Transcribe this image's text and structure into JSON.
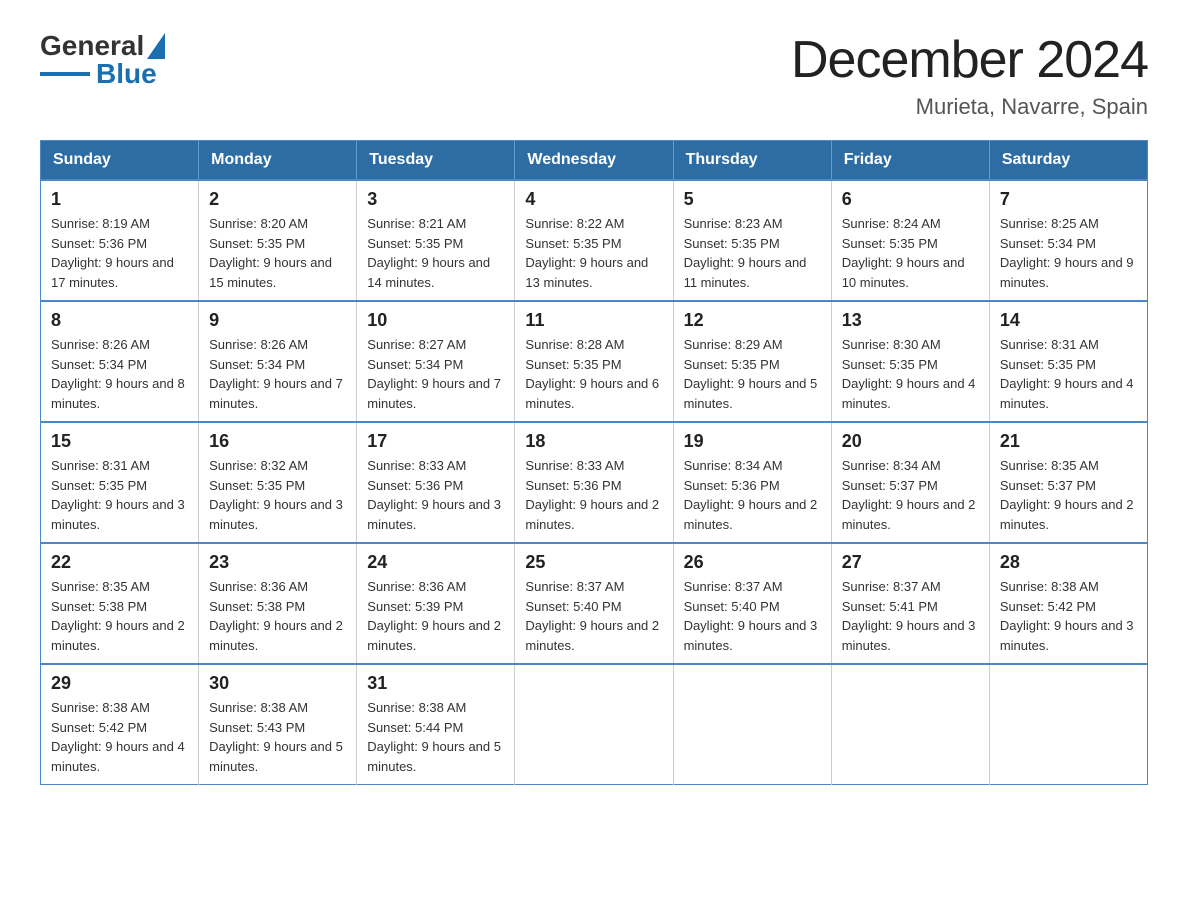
{
  "header": {
    "logo_general": "General",
    "logo_blue": "Blue",
    "month_year": "December 2024",
    "location": "Murieta, Navarre, Spain"
  },
  "days_of_week": [
    "Sunday",
    "Monday",
    "Tuesday",
    "Wednesday",
    "Thursday",
    "Friday",
    "Saturday"
  ],
  "weeks": [
    [
      {
        "day": "1",
        "sunrise": "8:19 AM",
        "sunset": "5:36 PM",
        "daylight": "9 hours and 17 minutes."
      },
      {
        "day": "2",
        "sunrise": "8:20 AM",
        "sunset": "5:35 PM",
        "daylight": "9 hours and 15 minutes."
      },
      {
        "day": "3",
        "sunrise": "8:21 AM",
        "sunset": "5:35 PM",
        "daylight": "9 hours and 14 minutes."
      },
      {
        "day": "4",
        "sunrise": "8:22 AM",
        "sunset": "5:35 PM",
        "daylight": "9 hours and 13 minutes."
      },
      {
        "day": "5",
        "sunrise": "8:23 AM",
        "sunset": "5:35 PM",
        "daylight": "9 hours and 11 minutes."
      },
      {
        "day": "6",
        "sunrise": "8:24 AM",
        "sunset": "5:35 PM",
        "daylight": "9 hours and 10 minutes."
      },
      {
        "day": "7",
        "sunrise": "8:25 AM",
        "sunset": "5:34 PM",
        "daylight": "9 hours and 9 minutes."
      }
    ],
    [
      {
        "day": "8",
        "sunrise": "8:26 AM",
        "sunset": "5:34 PM",
        "daylight": "9 hours and 8 minutes."
      },
      {
        "day": "9",
        "sunrise": "8:26 AM",
        "sunset": "5:34 PM",
        "daylight": "9 hours and 7 minutes."
      },
      {
        "day": "10",
        "sunrise": "8:27 AM",
        "sunset": "5:34 PM",
        "daylight": "9 hours and 7 minutes."
      },
      {
        "day": "11",
        "sunrise": "8:28 AM",
        "sunset": "5:35 PM",
        "daylight": "9 hours and 6 minutes."
      },
      {
        "day": "12",
        "sunrise": "8:29 AM",
        "sunset": "5:35 PM",
        "daylight": "9 hours and 5 minutes."
      },
      {
        "day": "13",
        "sunrise": "8:30 AM",
        "sunset": "5:35 PM",
        "daylight": "9 hours and 4 minutes."
      },
      {
        "day": "14",
        "sunrise": "8:31 AM",
        "sunset": "5:35 PM",
        "daylight": "9 hours and 4 minutes."
      }
    ],
    [
      {
        "day": "15",
        "sunrise": "8:31 AM",
        "sunset": "5:35 PM",
        "daylight": "9 hours and 3 minutes."
      },
      {
        "day": "16",
        "sunrise": "8:32 AM",
        "sunset": "5:35 PM",
        "daylight": "9 hours and 3 minutes."
      },
      {
        "day": "17",
        "sunrise": "8:33 AM",
        "sunset": "5:36 PM",
        "daylight": "9 hours and 3 minutes."
      },
      {
        "day": "18",
        "sunrise": "8:33 AM",
        "sunset": "5:36 PM",
        "daylight": "9 hours and 2 minutes."
      },
      {
        "day": "19",
        "sunrise": "8:34 AM",
        "sunset": "5:36 PM",
        "daylight": "9 hours and 2 minutes."
      },
      {
        "day": "20",
        "sunrise": "8:34 AM",
        "sunset": "5:37 PM",
        "daylight": "9 hours and 2 minutes."
      },
      {
        "day": "21",
        "sunrise": "8:35 AM",
        "sunset": "5:37 PM",
        "daylight": "9 hours and 2 minutes."
      }
    ],
    [
      {
        "day": "22",
        "sunrise": "8:35 AM",
        "sunset": "5:38 PM",
        "daylight": "9 hours and 2 minutes."
      },
      {
        "day": "23",
        "sunrise": "8:36 AM",
        "sunset": "5:38 PM",
        "daylight": "9 hours and 2 minutes."
      },
      {
        "day": "24",
        "sunrise": "8:36 AM",
        "sunset": "5:39 PM",
        "daylight": "9 hours and 2 minutes."
      },
      {
        "day": "25",
        "sunrise": "8:37 AM",
        "sunset": "5:40 PM",
        "daylight": "9 hours and 2 minutes."
      },
      {
        "day": "26",
        "sunrise": "8:37 AM",
        "sunset": "5:40 PM",
        "daylight": "9 hours and 3 minutes."
      },
      {
        "day": "27",
        "sunrise": "8:37 AM",
        "sunset": "5:41 PM",
        "daylight": "9 hours and 3 minutes."
      },
      {
        "day": "28",
        "sunrise": "8:38 AM",
        "sunset": "5:42 PM",
        "daylight": "9 hours and 3 minutes."
      }
    ],
    [
      {
        "day": "29",
        "sunrise": "8:38 AM",
        "sunset": "5:42 PM",
        "daylight": "9 hours and 4 minutes."
      },
      {
        "day": "30",
        "sunrise": "8:38 AM",
        "sunset": "5:43 PM",
        "daylight": "9 hours and 5 minutes."
      },
      {
        "day": "31",
        "sunrise": "8:38 AM",
        "sunset": "5:44 PM",
        "daylight": "9 hours and 5 minutes."
      },
      null,
      null,
      null,
      null
    ]
  ]
}
